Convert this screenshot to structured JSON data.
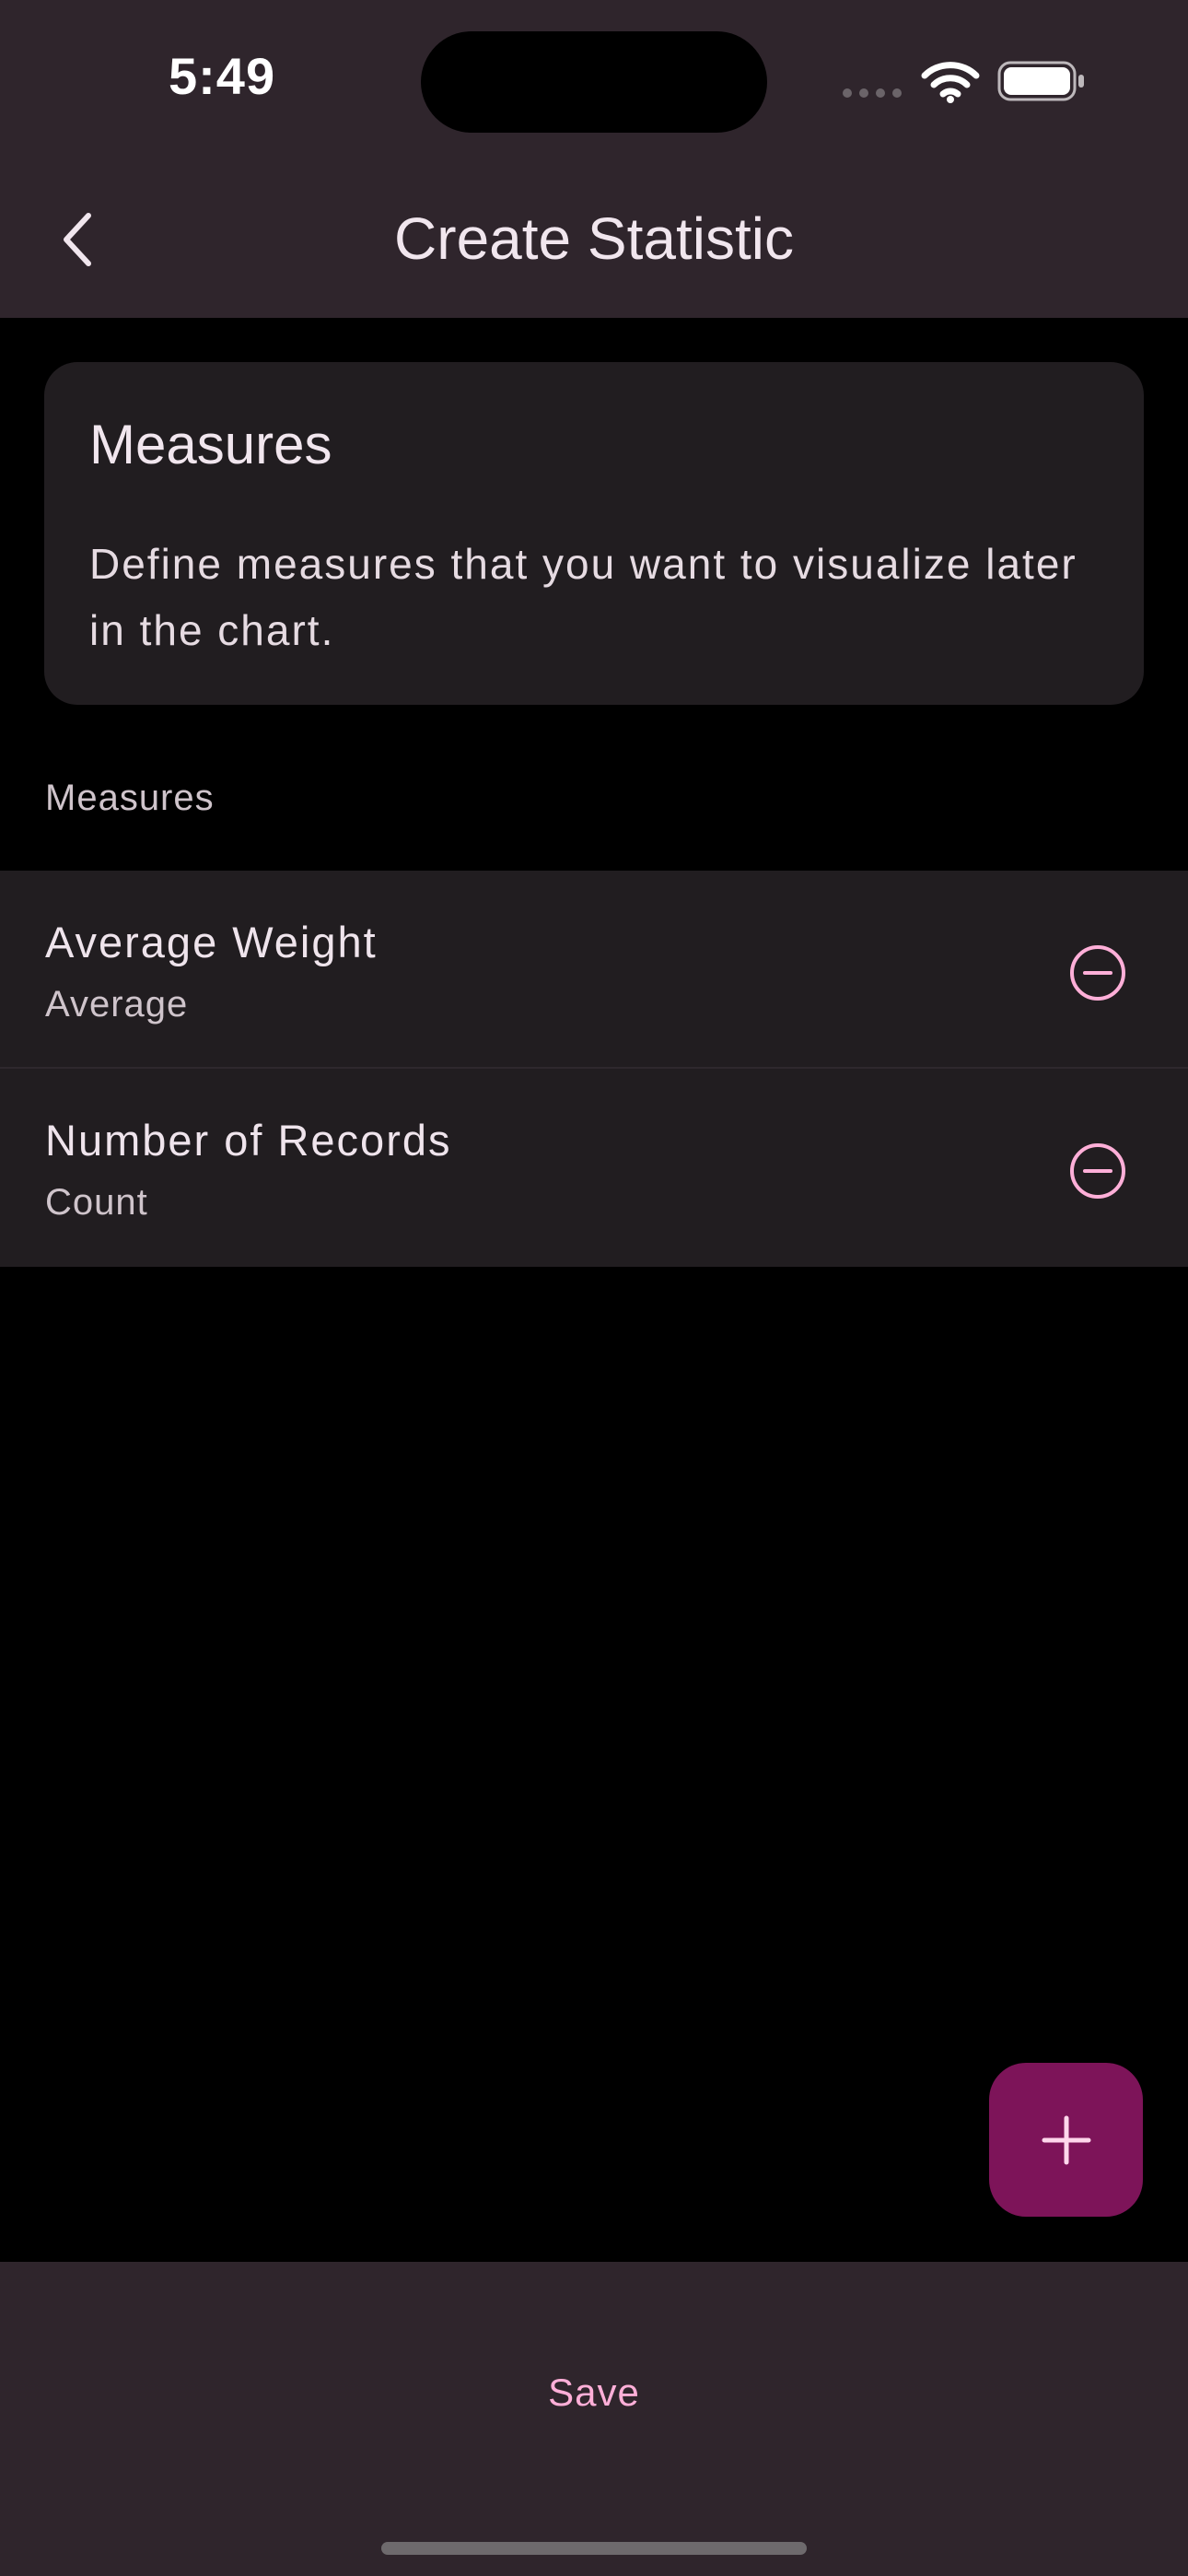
{
  "status_bar": {
    "time": "5:49"
  },
  "app_bar": {
    "title": "Create Statistic"
  },
  "info_card": {
    "title": "Measures",
    "description": "Define measures that you want to visualize later in the chart."
  },
  "measures_section": {
    "header": "Measures",
    "items": [
      {
        "title": "Average Weight",
        "subtitle": "Average"
      },
      {
        "title": "Number of Records",
        "subtitle": "Count"
      }
    ]
  },
  "bottom_bar": {
    "save_label": "Save"
  },
  "icons": {
    "back": "chevron-left-icon",
    "remove": "minus-circle-icon",
    "add": "plus-icon",
    "wifi": "wifi-icon",
    "battery": "battery-icon",
    "signal": "signal-icon"
  },
  "colors": {
    "bar_background": "#2f252c",
    "card_background": "#211d20",
    "accent_pink": "#ffafd8",
    "fab_background": "#7d1459",
    "page_background": "#000000"
  }
}
